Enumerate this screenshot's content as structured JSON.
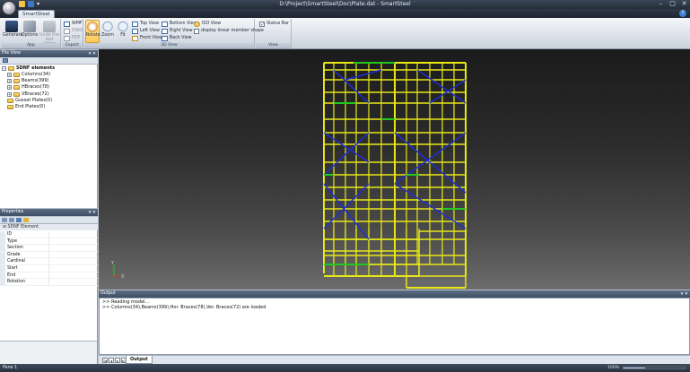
{
  "window": {
    "title": "D:\\Project\\SmartSteel\\Doc\\Plate.dat - SmartSteel"
  },
  "ribbon": {
    "tab": "SmartSteel",
    "groups": {
      "app": "App",
      "export": "Export",
      "view_3d": "3D View",
      "view": "View"
    },
    "buttons": {
      "generate": "Generate",
      "options": "Options",
      "undo": "Undo the last action",
      "rotate": "Rotate",
      "zoom": "Zoom",
      "fit": "Fit",
      "wmf": "WMF",
      "dwg": "DWG",
      "pdf": "PDF",
      "top_view": "Top View",
      "left_view": "Left View",
      "front_view": "Front View",
      "bottom_view": "Bottom View",
      "right_view": "Right View",
      "back_view": "Back View",
      "iso_view": "ISO View",
      "display_linear": "display linear member shape",
      "status_bar": "Status Bar"
    }
  },
  "file_view": {
    "title": "File View",
    "root": "SDNF elements",
    "items": [
      {
        "label": "Columns(34)",
        "expandable": true
      },
      {
        "label": "Beams(399)",
        "expandable": true
      },
      {
        "label": "HBraces(78)",
        "expandable": true
      },
      {
        "label": "VBraces(72)",
        "expandable": true
      },
      {
        "label": "Gusset Plates(0)",
        "expandable": false
      },
      {
        "label": "End Plates(0)",
        "expandable": false
      }
    ]
  },
  "properties": {
    "title": "Properties",
    "category": "SDNF Element",
    "rows": [
      "ID",
      "Type",
      "Section",
      "Grade",
      "Cardinal",
      "Start",
      "End",
      "Rotation"
    ]
  },
  "output": {
    "title": "Output",
    "lines": [
      ">> Reading model...",
      ">> Columns(34),Beams(399),Hor. Braces(78),Ver. Braces(72) are loaded"
    ],
    "tab": "Output"
  },
  "status": {
    "pane": "Pane 1",
    "zoom": "100%",
    "zoom_fraction": 0.35
  },
  "axis": {
    "x": "X",
    "y": "Y"
  },
  "colors": {
    "beam": "#e8e817",
    "hbrace": "#1c2fd8",
    "vbrace": "#22c81e",
    "accent": "#ffc95a"
  }
}
